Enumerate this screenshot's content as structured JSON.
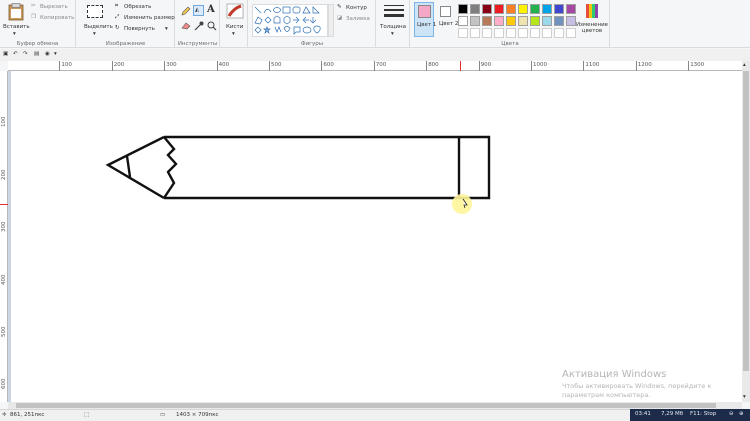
{
  "ribbon": {
    "clipboard": {
      "paste_label": "Вставить",
      "cut_label": "Вырезать",
      "copy_label": "Копировать",
      "group_label": "Буфер обмена"
    },
    "image": {
      "select_label": "Выделить",
      "crop_label": "Обрезать",
      "resize_label": "Изменить размер",
      "rotate_label": "Повернуть",
      "group_label": "Изображение"
    },
    "tools": {
      "group_label": "Инструменты",
      "text_glyph": "A"
    },
    "brushes": {
      "label": "Кисти"
    },
    "shapes": {
      "outline_label": "Контур",
      "fill_label": "Заливка",
      "group_label": "Фигуры"
    },
    "size": {
      "label": "Толщина"
    },
    "colors": {
      "color1_label": "Цвет 1",
      "color2_label": "Цвет 2",
      "group_label": "Цвета",
      "edit_label": "Изменение цветов",
      "color1": "#f4a7c6",
      "color2": "#ffffff",
      "palette_row1": [
        "#000000",
        "#7f7f7f",
        "#880015",
        "#ed1c24",
        "#ff7f27",
        "#fff200",
        "#22b14c",
        "#00a2e8",
        "#3f48cc",
        "#a349a4"
      ],
      "palette_row2": [
        "#ffffff",
        "#c3c3c3",
        "#b97a57",
        "#ffaec9",
        "#ffc90e",
        "#efe4b0",
        "#b5e61d",
        "#99d9ea",
        "#7092be",
        "#c8bfe7"
      ]
    }
  },
  "ruler": {
    "h_labels": [
      "100",
      "200",
      "300",
      "400",
      "500",
      "600",
      "700",
      "800",
      "900",
      "1000",
      "1100",
      "1200",
      "1300"
    ],
    "v_labels": [
      "100",
      "200",
      "300",
      "400",
      "500",
      "600"
    ]
  },
  "status": {
    "cursor_pos": "861, 251пкс",
    "image_size": "1403 × 709пкс"
  },
  "taskbar": {
    "time": "03:41",
    "memory": "7,29 Мб",
    "hotkey": "F11: Stop"
  },
  "watermark": {
    "title": "Активация Windows",
    "line1": "Чтобы активировать Windows, перейдите к",
    "line2": "параметрам компьютера."
  }
}
